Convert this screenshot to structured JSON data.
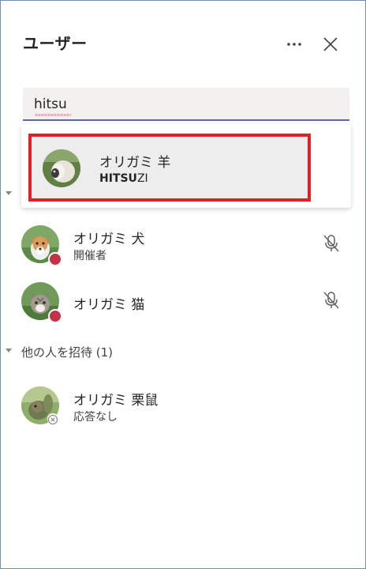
{
  "panel": {
    "title": "ユーザー"
  },
  "search": {
    "value": "hitsu",
    "placeholder": ""
  },
  "suggestion": {
    "name": "オリガミ 羊",
    "sub_bold": "HITSU",
    "sub_rest": "ZI"
  },
  "participants": [
    {
      "name": "オリガミ 犬",
      "role": "開催者",
      "status": "busy",
      "mic": "muted"
    },
    {
      "name": "オリガミ 猫",
      "role": "",
      "status": "busy",
      "mic": "muted"
    }
  ],
  "invited_section": {
    "label": "他の人を招待 (1)"
  },
  "invited": [
    {
      "name": "オリガミ 栗鼠",
      "role": "応答なし",
      "status": "offline"
    }
  ],
  "colors": {
    "accent": "#6264a7",
    "highlight_border": "#e01f27",
    "busy": "#c4314b"
  },
  "icons": [
    "more-icon",
    "close-icon",
    "mic-off-icon",
    "chevron-down-icon",
    "offline-status-icon"
  ]
}
